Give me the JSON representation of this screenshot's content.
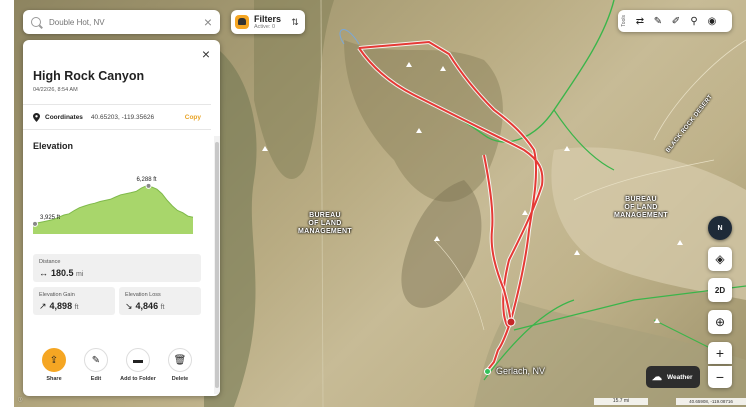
{
  "search": {
    "placeholder": "Double Hot, NV",
    "clear_icon": "close-icon"
  },
  "filters": {
    "title": "Filters",
    "subtitle": "Active: 0"
  },
  "tools": {
    "label": "Tools",
    "icons": [
      "route-icon",
      "draw-line-icon",
      "ruler-icon",
      "pin-icon",
      "camera-icon"
    ]
  },
  "panel": {
    "title": "High Rock Canyon",
    "date": "04/22/26, 8:54 AM",
    "coordinates_label": "Coordinates",
    "coordinates_value": "40.65203, -119.35626",
    "copy_label": "Copy",
    "elevation_title": "Elevation",
    "profile": {
      "min_label": "3,925 ft",
      "max_label": "6,288 ft",
      "min_ft": 3925,
      "max_ft": 6288,
      "series": [
        0.18,
        0.2,
        0.22,
        0.24,
        0.26,
        0.3,
        0.34,
        0.36,
        0.42,
        0.47,
        0.5,
        0.53,
        0.55,
        0.58,
        0.6,
        0.62,
        0.66,
        0.7,
        0.72,
        0.74,
        0.76,
        0.82,
        0.86,
        0.84,
        0.8,
        0.72,
        0.6,
        0.5,
        0.42,
        0.38,
        0.32,
        0.3
      ]
    },
    "distance_label": "Distance",
    "distance_value": "180.5",
    "distance_unit": "mi",
    "gain_label": "Elevation Gain",
    "gain_value": "4,898",
    "gain_unit": "ft",
    "loss_label": "Elevation Loss",
    "loss_value": "4,846",
    "loss_unit": "ft",
    "actions": [
      {
        "label": "Share",
        "icon": "share-icon"
      },
      {
        "label": "Edit",
        "icon": "pencil-icon"
      },
      {
        "label": "Add to Folder",
        "icon": "folder-icon"
      },
      {
        "label": "Delete",
        "icon": "trash-icon"
      }
    ]
  },
  "map": {
    "labels": {
      "blm_left": "BUREAU\nOF LAND\nMANAGEMENT",
      "blm_right": "BUREAU\nOF LAND\nMANAGEMENT",
      "black_rock": "BLACK ROCK DESERT",
      "gerlach": "Gerlach, NV"
    },
    "compass": "N",
    "mode_2d": "2D",
    "weather": "Weather",
    "scale": "15.7 mi",
    "cursor_coords": "40.65908, -119.08716",
    "route_color": "#e53935",
    "trail_color": "#3ab54a"
  }
}
